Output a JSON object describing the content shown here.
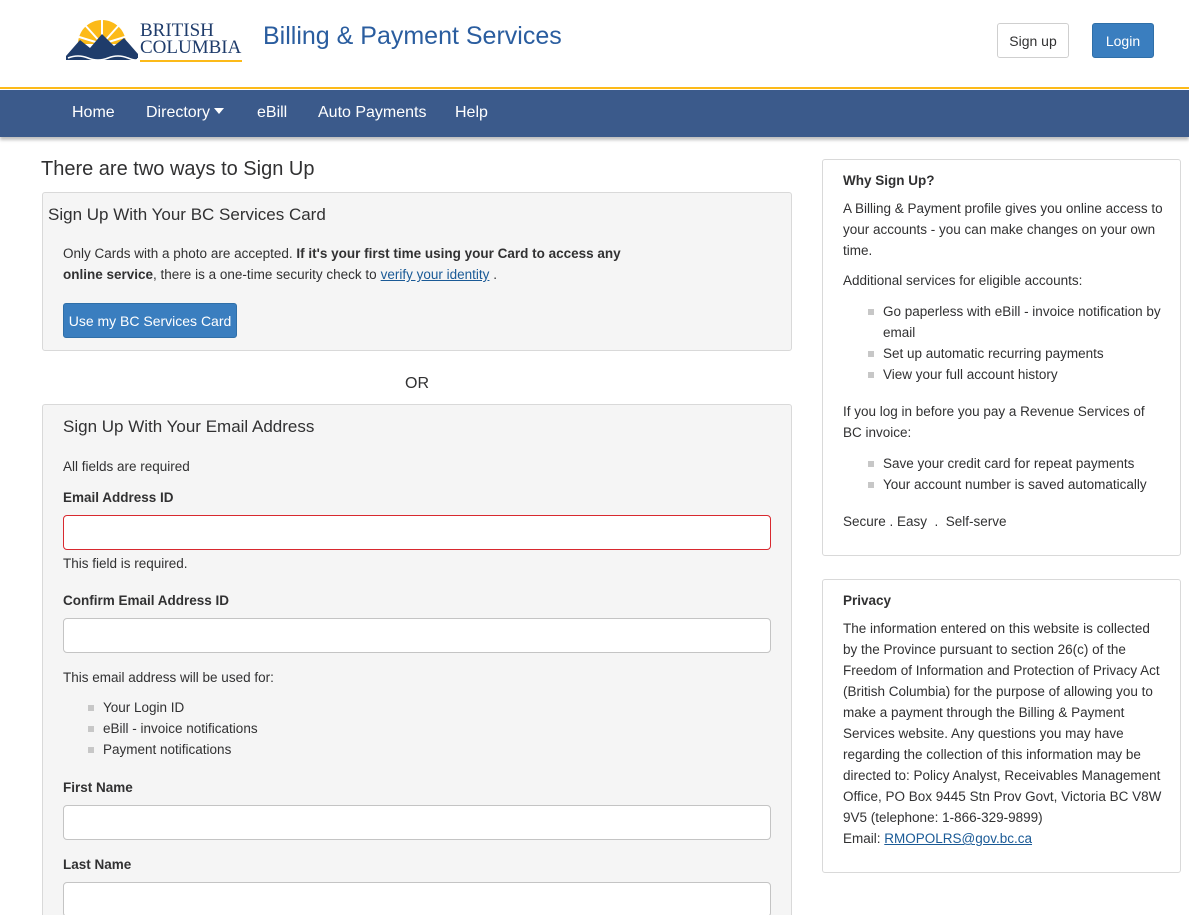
{
  "header": {
    "logo_line1": "BRITISH",
    "logo_line2": "COLUMBIA",
    "site_title": "Billing & Payment Services",
    "signup_label": "Sign up",
    "login_label": "Login"
  },
  "nav": {
    "items": [
      {
        "label": "Home"
      },
      {
        "label": "Directory"
      },
      {
        "label": "eBill"
      },
      {
        "label": "Auto Payments"
      },
      {
        "label": "Help"
      }
    ]
  },
  "main": {
    "heading": "There are two ways to Sign Up",
    "card_panel": {
      "title": "Sign Up With Your BC Services Card",
      "text_plain": "Only Cards with a photo are accepted. ",
      "text_bold": "If it's your first time using your Card to access any online service",
      "text_after": ", there is a one-time security check to",
      "link_label": "verify your identity",
      "text_end": ".",
      "button_label": "Use my BC Services Card"
    },
    "or_label": "OR",
    "email_panel": {
      "title": "Sign Up With Your Email Address",
      "required_note": "All fields are required",
      "email_label": "Email Address ID",
      "email_value": "",
      "email_error": "This field is required.",
      "confirm_label": "Confirm Email Address ID",
      "confirm_value": "",
      "uses_intro": "This email address will be used for:",
      "uses": [
        "Your Login ID",
        "eBill - invoice notifications",
        "Payment notifications"
      ],
      "first_name_label": "First Name",
      "first_name_value": "",
      "last_name_label": "Last Name",
      "last_name_value": ""
    }
  },
  "sidebar": {
    "why": {
      "title": "Why Sign Up?",
      "intro": "A Billing & Payment profile gives you online access to your accounts - you can make changes on your own time.",
      "additional_intro": "Additional services for eligible accounts:",
      "additional_items": [
        "Go paperless with eBill - invoice notification by email",
        "Set up automatic recurring payments",
        "View your full account history"
      ],
      "rev_intro": "If you log in before you pay a Revenue Services of BC invoice:",
      "rev_items": [
        "Save your credit card for repeat payments",
        "Your account number is saved automatically"
      ],
      "tagline": "Secure . Easy  .  Self-serve"
    },
    "privacy": {
      "title": "Privacy",
      "text": "The information entered on this website is collected by the Province pursuant to section 26(c) of the Freedom of Information and Protection of Privacy Act (British Columbia) for the purpose of allowing you to make a payment through the Billing & Payment Services website. Any questions you may have regarding the collection of this information may be directed to: Policy Analyst, Receivables Management Office, PO Box 9445 Stn Prov Govt, Victoria BC V8W 9V5 (telephone: 1-866-329-9899)",
      "email_prefix": "Email:",
      "email_link": "RMOPOLRS@gov.bc.ca"
    }
  },
  "colors": {
    "brand_blue": "#3b5a8b",
    "button_blue": "#3a7ebf",
    "gold": "#fcba19",
    "error_red": "#d8292f"
  }
}
